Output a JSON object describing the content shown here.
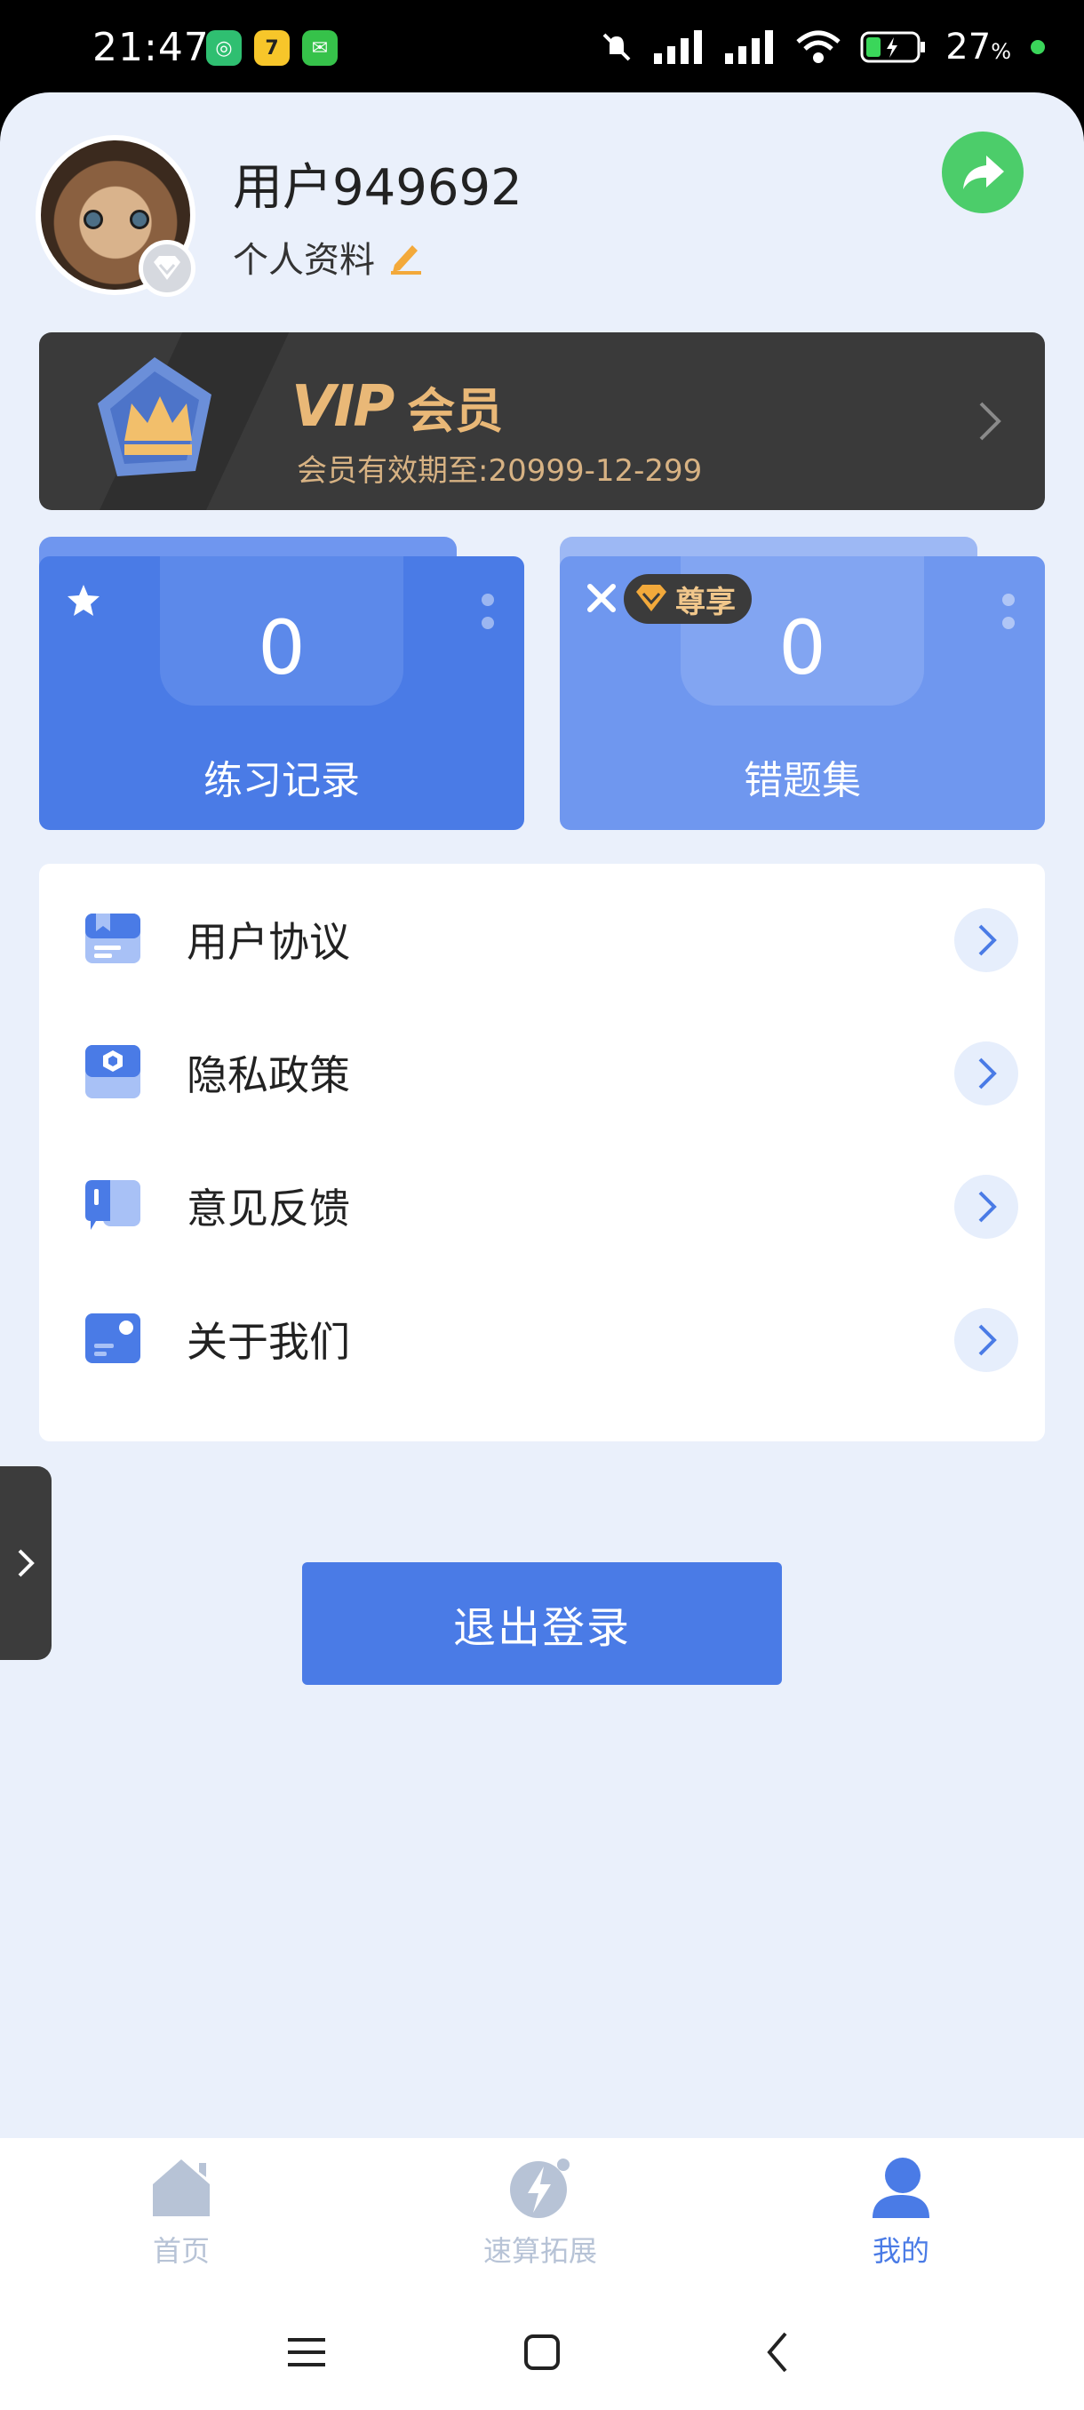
{
  "status_bar": {
    "time": "21:47",
    "battery_percent": "27",
    "battery_unit": "%"
  },
  "profile": {
    "username": "用户949692",
    "edit_profile_label": "个人资料"
  },
  "vip": {
    "logo_text": "VIP",
    "label": "会员",
    "expiry": "会员有效期至:20999-12-299"
  },
  "stats": {
    "practice": {
      "value": "0",
      "label": "练习记录"
    },
    "wrong": {
      "value": "0",
      "label": "错题集",
      "tag": "尊享"
    }
  },
  "menu": {
    "items": [
      {
        "label": "用户协议"
      },
      {
        "label": "隐私政策"
      },
      {
        "label": "意见反馈"
      },
      {
        "label": "关于我们"
      }
    ]
  },
  "logout_label": "退出登录",
  "tabs": [
    {
      "label": "首页",
      "active": false
    },
    {
      "label": "速算拓展",
      "active": false
    },
    {
      "label": "我的",
      "active": true
    }
  ],
  "colors": {
    "primary": "#4a7be6",
    "vip_gold": "#e9b877",
    "share_green": "#4ccd6a",
    "page_bg": "#eaf0fb",
    "tab_inactive": "#b7c3d6"
  }
}
